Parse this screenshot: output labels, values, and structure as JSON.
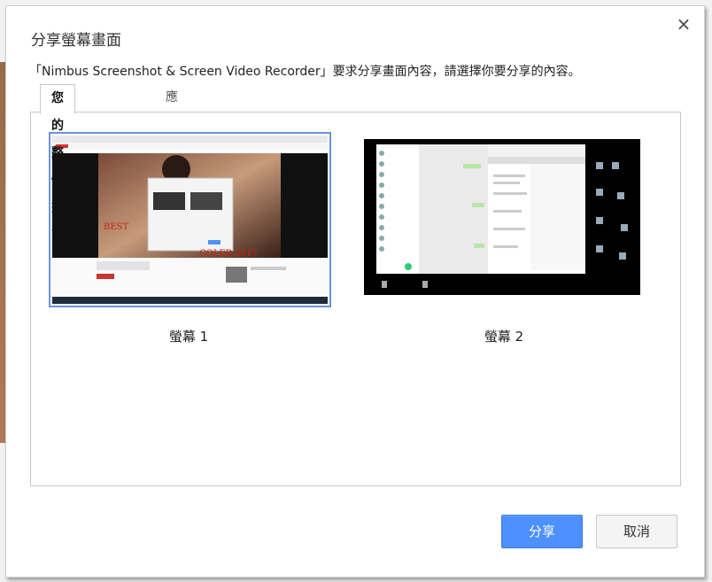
{
  "dialog": {
    "title": "分享螢幕畫面",
    "description": "「Nimbus Screenshot & Screen Video Recorder」要求分享畫面內容，請選擇你要分享的內容。",
    "close_glyph": "×"
  },
  "tabs": [
    {
      "label": "您的整個畫面",
      "active": true
    },
    {
      "label": "應用程式視窗",
      "active": false
    }
  ],
  "screens": [
    {
      "label": "螢幕 1",
      "selected": true
    },
    {
      "label": "螢幕 2",
      "selected": false
    }
  ],
  "buttons": {
    "share": "分享",
    "cancel": "取消"
  },
  "colors": {
    "accent": "#4d90fe",
    "selection_border": "#6a95d8"
  }
}
